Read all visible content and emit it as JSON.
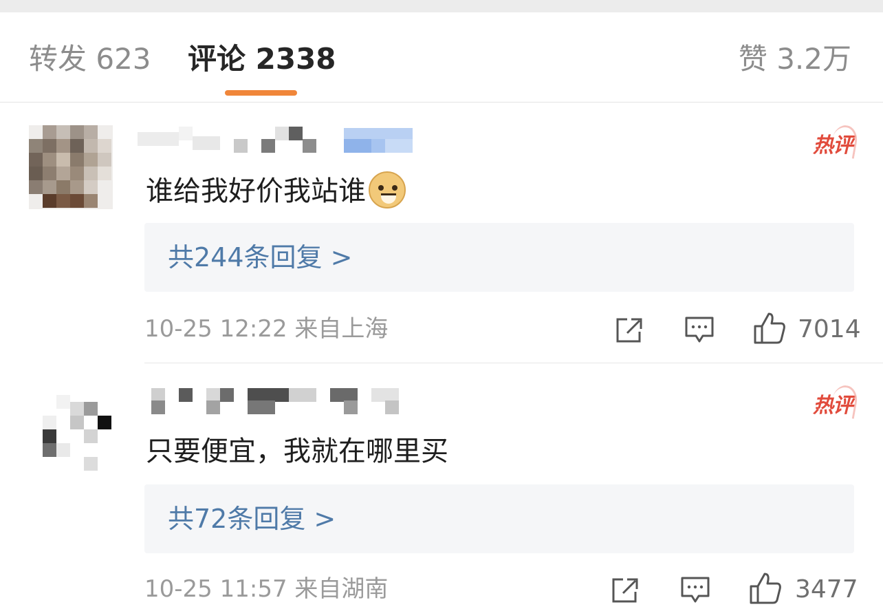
{
  "tabs": {
    "repost": "转发 623",
    "comments": "评论 2338",
    "likes": "赞 3.2万"
  },
  "comments": [
    {
      "hot_badge": "热评",
      "text": "谁给我好价我站谁",
      "emoji": "doge",
      "replies": "共244条回复 >",
      "time_location": "10-25 12:22 来自上海",
      "likes": "7014"
    },
    {
      "hot_badge": "热评",
      "text": "只要便宜，我就在哪里买",
      "replies": "共72条回复 >",
      "time_location": "10-25 11:57 来自湖南",
      "likes": "3477"
    }
  ],
  "icons": {
    "share": "share-icon",
    "reply": "comment-icon",
    "like": "thumbs-up-icon"
  },
  "colors": {
    "tab_underline": "#f0863a",
    "reply_link": "#4f7aa8",
    "hot_badge": "#e14b3c"
  }
}
